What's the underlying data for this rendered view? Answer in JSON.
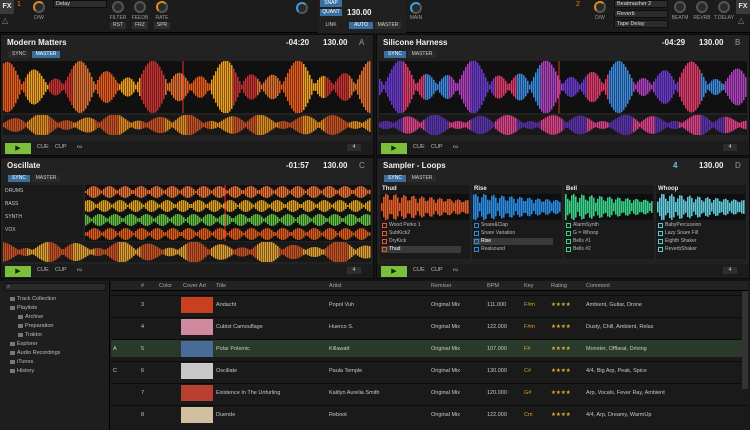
{
  "fx_left": {
    "fx": "FX",
    "unit": "1",
    "knob_label": "D/W",
    "effect": "Delay",
    "knobs": [
      "FILTER",
      "FEEDB",
      "RATE"
    ],
    "buttons": [
      "RST",
      "FRZ",
      "SPR"
    ]
  },
  "fx_right": {
    "fx": "FX",
    "unit": "2",
    "knob_label": "D/W",
    "effects": [
      "Beatmasher 2",
      "Reverb",
      "Tape Delay"
    ],
    "knobs": [
      "BEATM",
      "REVRB",
      "T.DELAY"
    ]
  },
  "center": {
    "snap": "SNAP",
    "quant": "QUANT",
    "bpm": "130.00",
    "link": "LINK",
    "auto": "AUTO",
    "master": "MASTER",
    "main": "MAIN"
  },
  "deckA": {
    "title": "Modern Matters",
    "time": "-04:20",
    "bpm": "130.00",
    "letter": "A",
    "sync": "SYNC",
    "master": "MASTER",
    "cue": "CUE",
    "cup": "CUP",
    "loop": "4"
  },
  "deckB": {
    "title": "Silicone Harness",
    "time": "-04:29",
    "bpm": "130.00",
    "letter": "B",
    "sync": "SYNC",
    "master": "MASTER",
    "cue": "CUE",
    "cup": "CUP",
    "loop": "4"
  },
  "deckC": {
    "title": "Oscillate",
    "time": "-01:57",
    "bpm": "130.00",
    "letter": "C",
    "sync": "SYNC",
    "master": "MASTER",
    "stems": [
      "DRUMS",
      "BASS",
      "SYNTH",
      "VOX"
    ],
    "cue": "CUE",
    "cup": "CUP",
    "loop": "4"
  },
  "deckD": {
    "title": "Sampler - Loops",
    "count": "4",
    "bpm": "130.00",
    "letter": "D",
    "sync": "SYNC",
    "master": "MASTER",
    "cue": "CUE",
    "cup": "CUP",
    "loop": "4",
    "slots": [
      {
        "name": "Thud",
        "color": "#e05a2a",
        "items": [
          "Wood Perko 1",
          "SubKick2",
          "DryKick",
          "Thud"
        ]
      },
      {
        "name": "Rise",
        "color": "#2a8ae0",
        "items": [
          "Snare&Clap",
          "Snare Variation",
          "Rise",
          "Realsound"
        ]
      },
      {
        "name": "Bell",
        "color": "#3ad08a",
        "items": [
          "AlarmSynth",
          "G = Whoop",
          "Bells #1",
          "Bells #2"
        ]
      },
      {
        "name": "Whoop",
        "color": "#60c8d8",
        "items": [
          "BabyPercussion",
          "Lazy Snare Fill",
          "Eighth Shaker",
          "ReverbShaker"
        ]
      }
    ]
  },
  "browser": {
    "search_placeholder": "",
    "tree": [
      "Track Collection",
      "Playlists",
      "Archive",
      "Preparation",
      "Traktor",
      "Explorer",
      "Audio Recordings",
      "iTunes",
      "History"
    ],
    "headers": [
      "#",
      "Color",
      "Cover Art",
      "Title",
      "Artist",
      "Remixer",
      "BPM",
      "Key",
      "Rating",
      "Comment"
    ],
    "rows": [
      {
        "num": "3",
        "title": "Andacht",
        "artist": "Popol Vuh",
        "remixer": "Original Mix",
        "bpm": "111.000",
        "key": "F#m",
        "rating": "★★★★",
        "comment": "Ambient, Guitar, Drone",
        "cover": "#c84020",
        "deck": ""
      },
      {
        "num": "4",
        "title": "Cubist Camouflage",
        "artist": "Huerco S.",
        "remixer": "Original Mix",
        "bpm": "122.000",
        "key": "F#m",
        "rating": "★★★★",
        "comment": "Dusty, Chill, Ambient, Relax",
        "cover": "#d08aa0",
        "deck": ""
      },
      {
        "num": "5",
        "title": "Polar Polemic",
        "artist": "Killawatt",
        "remixer": "Original Mix",
        "bpm": "107.000",
        "key": "F#",
        "rating": "★★★★",
        "comment": "Monster, Offbeat, Driving",
        "cover": "#4a6a9a",
        "deck": "A"
      },
      {
        "num": "6",
        "title": "Oscillate",
        "artist": "Paula Temple",
        "remixer": "Original Mix",
        "bpm": "130.000",
        "key": "C#",
        "rating": "★★★★",
        "comment": "4/4, Big Arp, Peak, Spice",
        "cover": "#c8c8c8",
        "deck": "C"
      },
      {
        "num": "7",
        "title": "Existence In The Unfurling",
        "artist": "Kaitlyn Aurelia Smith",
        "remixer": "Original Mix",
        "bpm": "120.000",
        "key": "G#",
        "rating": "★★★★",
        "comment": "Arp, Vocals, Fever Ray, Ambient",
        "cover": "#b84030",
        "deck": ""
      },
      {
        "num": "8",
        "title": "Duende",
        "artist": "Reboot",
        "remixer": "Original Mix",
        "bpm": "122.000",
        "key": "Cm",
        "rating": "★★★★",
        "comment": "4/4, Arp, Dreamy, WarmUp",
        "cover": "#d0c0a0",
        "deck": ""
      }
    ]
  },
  "colors": {
    "accent": "#e08a1e",
    "sync": "#3a6fa0",
    "play": "#7bbf3a",
    "selected_row": "#2a3a2a"
  }
}
